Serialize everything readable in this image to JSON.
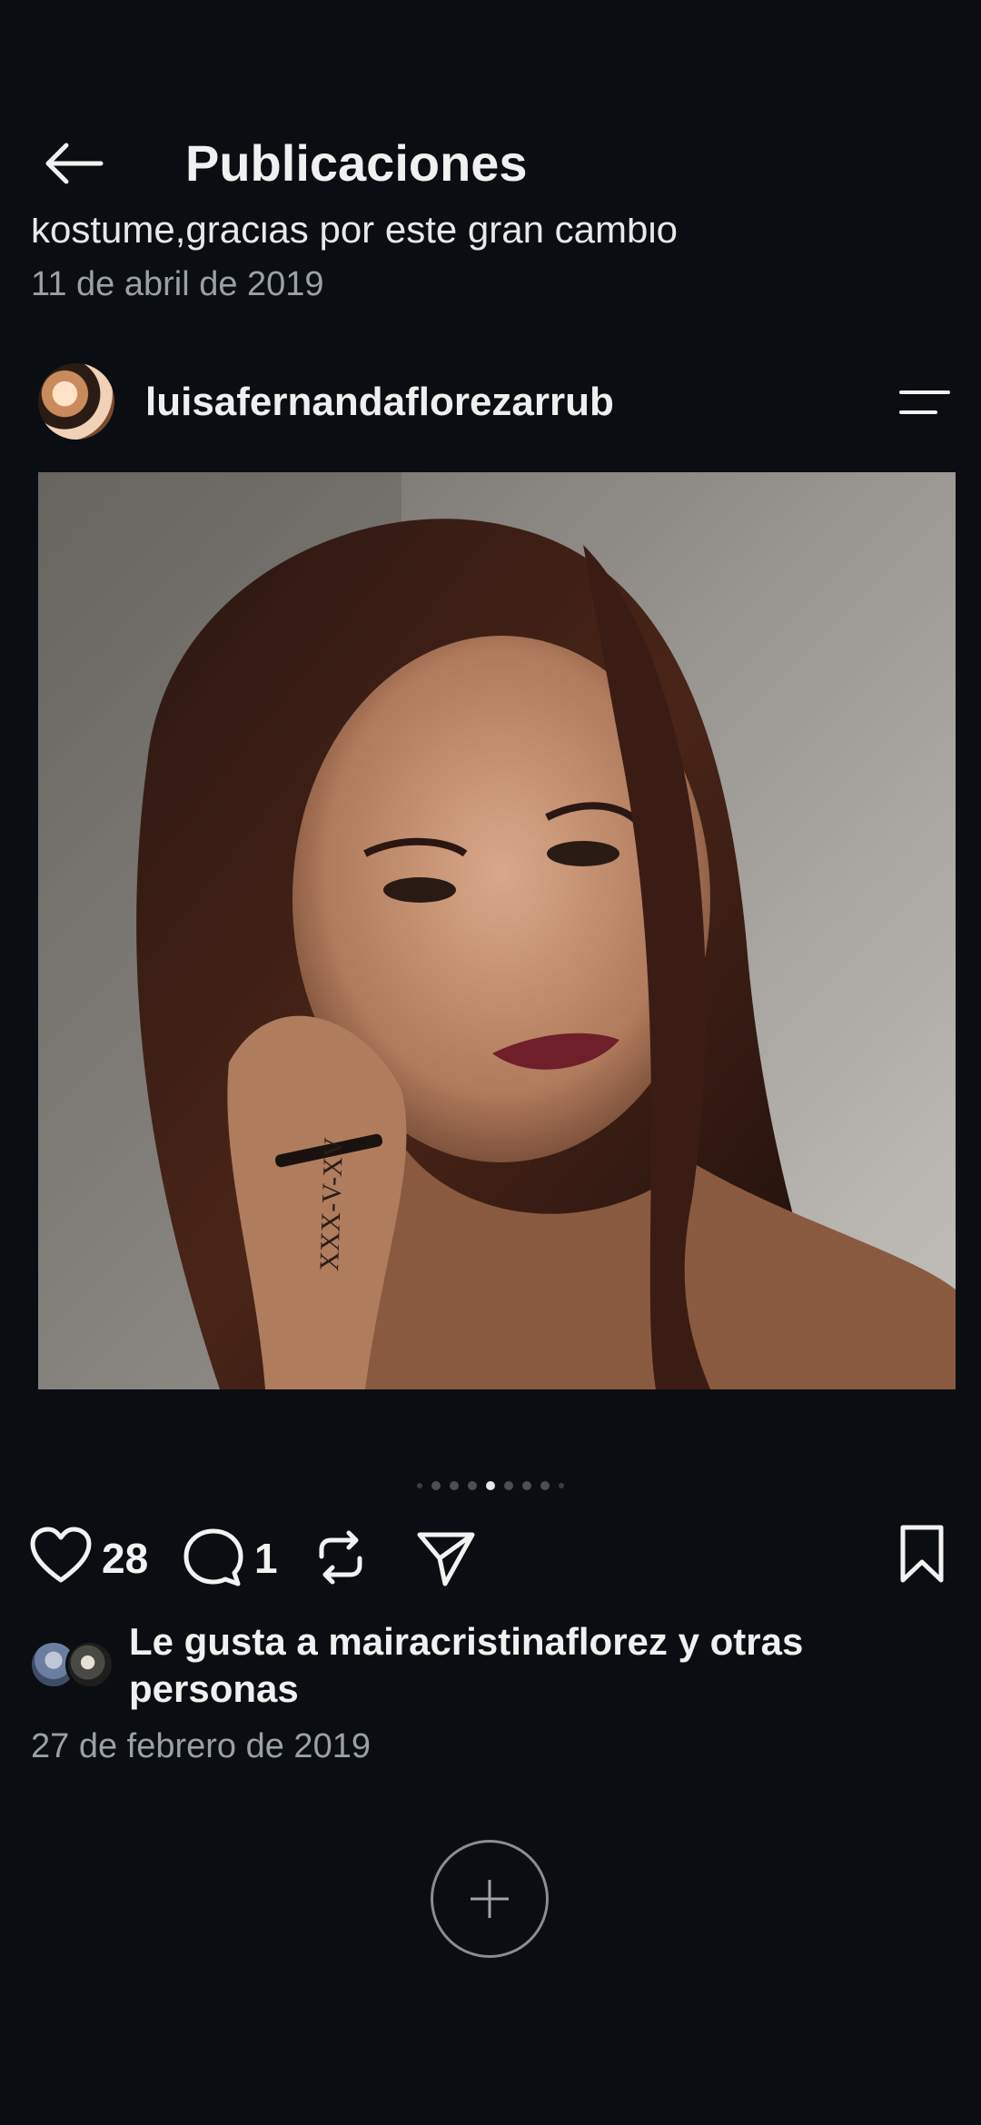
{
  "header": {
    "title": "Publicaciones"
  },
  "previous_post": {
    "caption_fragment": "kostume,gracias por este gran cambio",
    "date": "11 de abril de 2019"
  },
  "post": {
    "username": "luisafernandaflorezarrub",
    "likes_count": "28",
    "comments_count": "1",
    "likes_prefix": "Le gusta a ",
    "liker_name": "mairacristinaflorez",
    "likes_joiner": " y ",
    "likes_suffix": "otras personas",
    "date": "27 de febrero de 2019",
    "tattoo_text": "XXX-V-XV",
    "carousel": {
      "total": 9,
      "active": 4
    }
  },
  "colors": {
    "background": "#0a0d11",
    "text": "#f2f2f2",
    "muted": "#9aa0a6"
  },
  "icons": [
    "back-arrow-icon",
    "menu-icon",
    "heart-icon",
    "comment-icon",
    "repost-icon",
    "send-icon",
    "bookmark-icon",
    "plus-icon"
  ]
}
